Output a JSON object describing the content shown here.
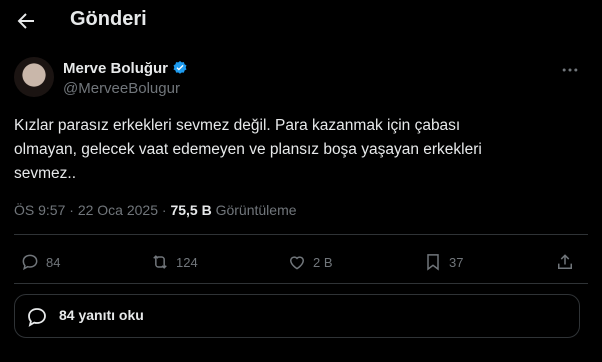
{
  "header": {
    "title": "Gönderi",
    "back_icon": "arrow-left-icon"
  },
  "author": {
    "name": "Merve Boluğur",
    "handle": "@MerveeBolugur",
    "verified_color": "#1d9bf0"
  },
  "tweet": {
    "text": "Kızlar parasız erkekleri sevmez değil. Para kazanmak için çabası\nolmayan, gelecek vaat edemeyen ve plansız boşa yaşayan erkekleri\nsevmez..",
    "time": "ÖS 9:57",
    "separator": "·",
    "date": "22 Oca 2025",
    "views": "75,5 B",
    "views_label": "Görüntüleme"
  },
  "actions": {
    "replies": "84",
    "retweets": "124",
    "likes": "2 B",
    "bookmarks": "37"
  },
  "read_replies": {
    "label": "84 yanıtı oku",
    "icon": "speech-bubble-icon"
  },
  "colors": {
    "background": "#000000",
    "text": "#e7e9ea",
    "muted": "#71767b",
    "border": "#2f3336"
  }
}
